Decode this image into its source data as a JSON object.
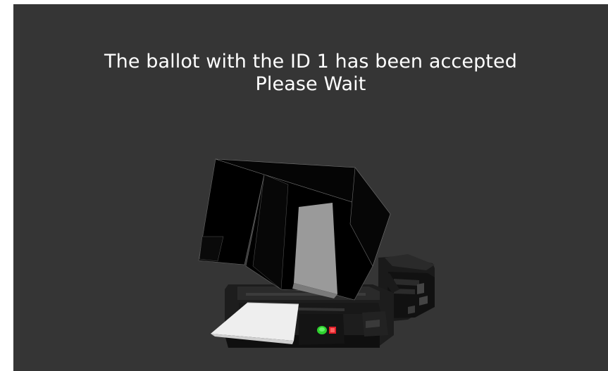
{
  "message": {
    "line1": "The ballot with the ID 1 has been accepted",
    "line2": "Please Wait"
  },
  "illustration": {
    "name": "ballot-scanner-illustration",
    "status_lights": {
      "green": "#2fd12f",
      "red": "#e0202a"
    }
  },
  "colors": {
    "background": "#353535",
    "text": "#ffffff",
    "paper": "#eeeeee"
  }
}
